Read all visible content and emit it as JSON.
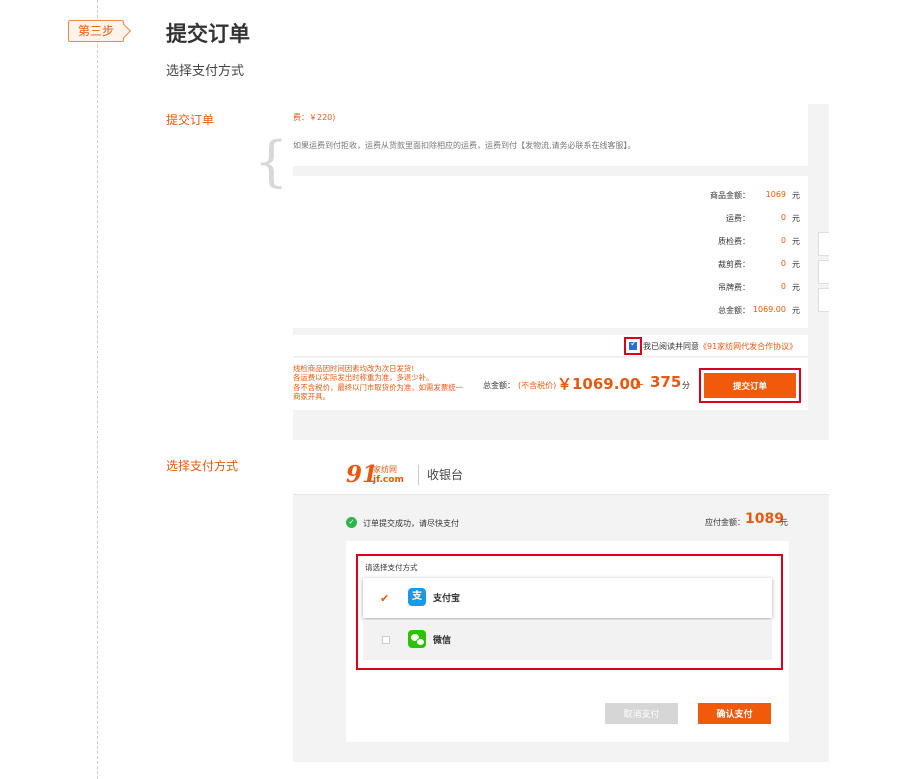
{
  "step": {
    "badge": "第三步",
    "title": "提交订单",
    "subtitle": "选择支付方式"
  },
  "sections": {
    "submit_label": "提交订单",
    "pay_label": "选择支付方式"
  },
  "order": {
    "ship_fee": "费：￥220)",
    "ship_note": "如果运费到付拒收，运费从货款里面扣除相应的运费，运费到付【发物流,请务必联系在线客服】。",
    "summary": [
      {
        "label": "商品金额：",
        "value": "1069",
        "unit": "元"
      },
      {
        "label": "运费：",
        "value": "0",
        "unit": "元"
      },
      {
        "label": "质检费：",
        "value": "0",
        "unit": "元"
      },
      {
        "label": "裁剪费：",
        "value": "0",
        "unit": "元"
      },
      {
        "label": "吊牌费：",
        "value": "0",
        "unit": "元"
      },
      {
        "label": "总金额：",
        "value": "1069.00",
        "unit": "元"
      }
    ],
    "agree_prefix": "我已阅读并同意",
    "agree_link": "《91家纺网代发合作协议》",
    "warning_lines": [
      "线检商品因时间因素均改为次日发货!",
      "各运费以实际发出时称重为准，多退少补。",
      "各不含税价，最终以门市取货价为准，如需发票统一",
      "商家开具。"
    ],
    "total_label": "总金额：",
    "tax_note": "(不含税价)",
    "total_amount": "￥1069.00",
    "plus": "+",
    "points": "375",
    "points_unit": "分",
    "submit_button": "提交订单"
  },
  "payment": {
    "logo_number": "91",
    "logo_cn": "家纺网",
    "logo_en": "jf.com",
    "cashier": "收银台",
    "success_msg": "订单提交成功，请尽快支付",
    "due_label": "应付金额：",
    "due_amount": "1089",
    "due_unit": "元",
    "method_title": "请选择支付方式",
    "methods": [
      {
        "name": "支付宝",
        "selected": true,
        "icon": "alipay-icon"
      },
      {
        "name": "微信",
        "selected": false,
        "icon": "wechat-icon"
      }
    ],
    "cancel_button": "取消支付",
    "confirm_button": "确认支付"
  },
  "colors": {
    "accent": "#e8590f",
    "highlight_border": "#d9001b",
    "button": "#f05a0a",
    "alipay": "#1a9ae0",
    "wechat": "#2dc100",
    "success": "#2fb44a"
  }
}
